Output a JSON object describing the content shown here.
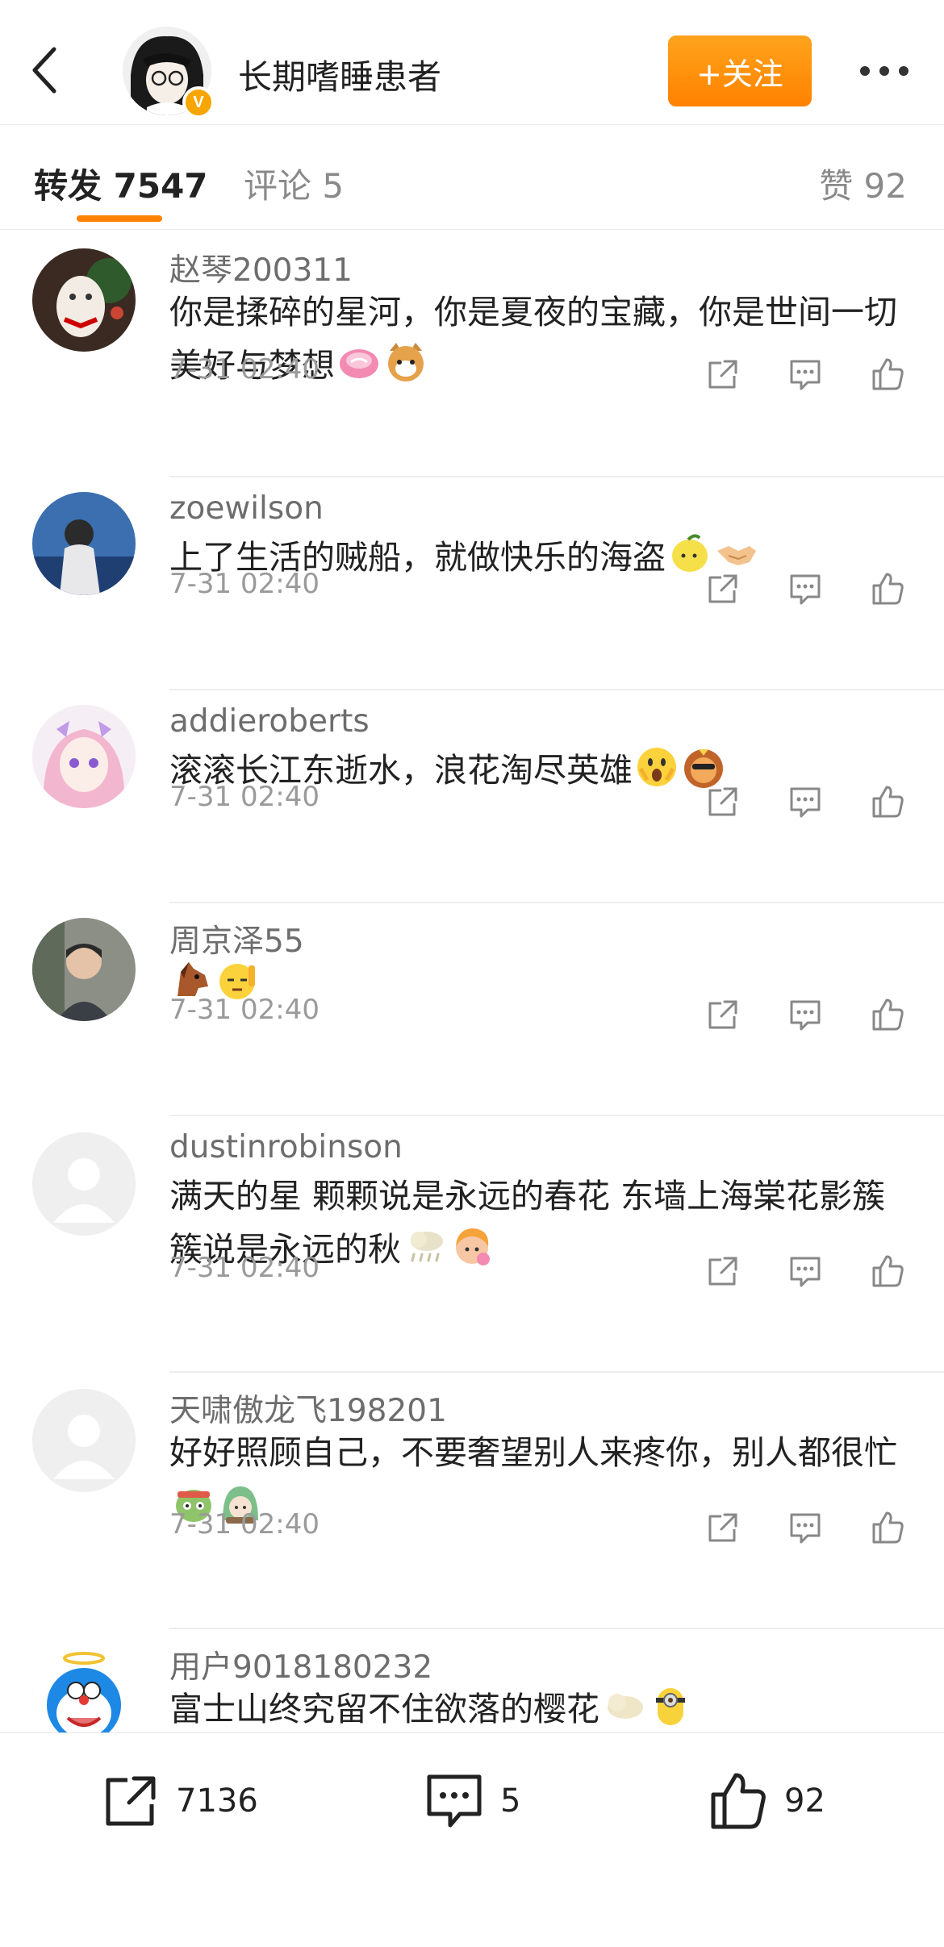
{
  "header": {
    "username": "长期嗜睡患者",
    "follow_label": "+关注"
  },
  "tabs": {
    "repost": "转发 7547",
    "comment": "评论 5",
    "like": "赞 92"
  },
  "colors": {
    "accent": "#ff8200",
    "verified": "#f7a500"
  },
  "items": [
    {
      "name": "赵琴200311",
      "text": "你是揉碎的星河，你是夏夜的宝藏，你是世间一切美好与梦想",
      "time": "7-31 02:40",
      "emojis": [
        "candy-emoji",
        "cat-emoji"
      ]
    },
    {
      "name": "zoewilson",
      "text": "上了生活的贼船，就做快乐的海盗",
      "time": "7-31 02:40",
      "emojis": [
        "lemon-emoji",
        "handshake-emoji"
      ]
    },
    {
      "name": "addieroberts",
      "text": "滚滚长江东逝水，浪花淘尽英雄",
      "time": "7-31 02:40",
      "emojis": [
        "surprised-emoji",
        "lion-emoji"
      ]
    },
    {
      "name": "周京泽55",
      "text": "",
      "time": "7-31 02:40",
      "emojis": [
        "horse-emoji",
        "salute-emoji"
      ]
    },
    {
      "name": "dustinrobinson",
      "text": "满天的星 颗颗说是永远的春花 东墙上海棠花影簇簇说是永远的秋",
      "time": "7-31 02:40",
      "emojis": [
        "rain-cloud-emoji",
        "cute-girl-emoji"
      ]
    },
    {
      "name": "天啸傲龙飞198201",
      "text": "好好照顾自己，不要奢望别人来疼你，别人都很忙",
      "time": "7-31 02:40",
      "emojis": [
        "green-monster-emoji",
        "green-hair-emoji"
      ]
    },
    {
      "name": "用户9018180232",
      "text": "富士山终究留不住欲落的樱花",
      "time": "",
      "emojis": [
        "cloud-emoji",
        "minion-emoji"
      ]
    }
  ],
  "bottom": {
    "repost_count": "7136",
    "comment_count": "5",
    "like_count": "92"
  }
}
